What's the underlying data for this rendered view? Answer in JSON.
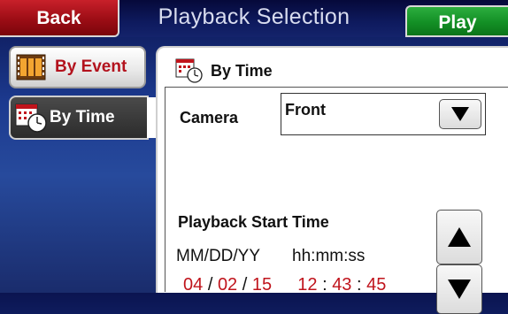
{
  "header": {
    "title": "Playback Selection",
    "back_label": "Back",
    "play_label": "Play"
  },
  "sidebar": {
    "items": [
      {
        "label": "By Event",
        "icon": "film-icon",
        "selected": false
      },
      {
        "label": "By Time",
        "icon": "calendar-clock-icon",
        "selected": true
      }
    ]
  },
  "panel": {
    "title": "By Time",
    "camera_label": "Camera",
    "camera_value": "Front",
    "start_time_label": "Playback Start Time",
    "format": {
      "mm": "MM",
      "dd": "DD",
      "yy": "YY",
      "hh": "hh",
      "min": "mm",
      "ss": "ss"
    },
    "value": {
      "month": "04",
      "day": "02",
      "year": "15",
      "hour": "12",
      "minute": "43",
      "second": "45"
    },
    "date_sep": "/",
    "time_sep": ":"
  },
  "colors": {
    "back": "#9c0d15",
    "play": "#138f25",
    "value_text": "#c0141c",
    "background": "#1c3a8f"
  }
}
